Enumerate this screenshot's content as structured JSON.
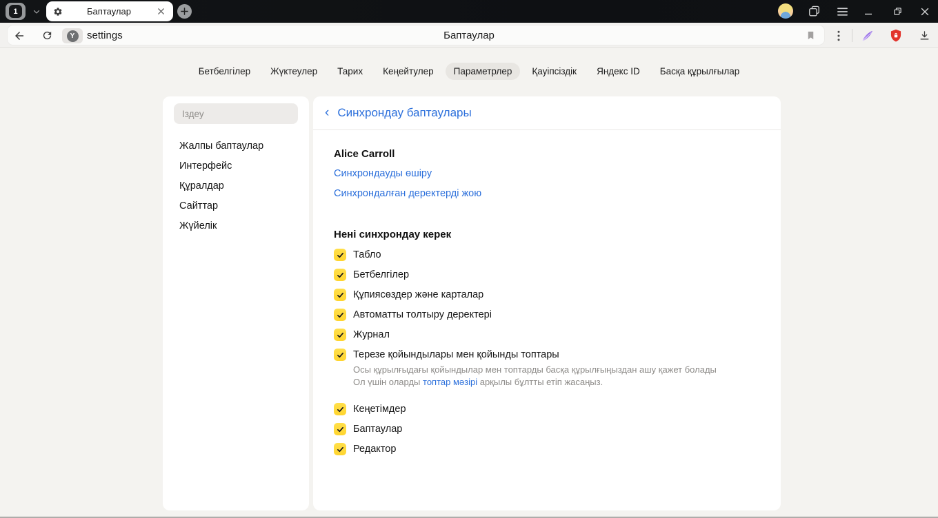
{
  "window": {
    "tab_count": "1",
    "tab_title": "Баптаулар",
    "address": "settings",
    "page_title": "Баптаулар"
  },
  "icons": {
    "tab_favicon": "gear",
    "new_tab": "+",
    "toolbar": [
      "back-arrow",
      "refresh",
      "site-badge",
      "bookmark-flag",
      "more-dots",
      "feather-extension",
      "protect-shield",
      "download-arrow"
    ],
    "titlebar": [
      "tab-counter",
      "chevron-down",
      "avatar",
      "collections",
      "hamburger-menu",
      "minimize",
      "restore",
      "close"
    ]
  },
  "colors": {
    "accent_blue": "#2b6fdb",
    "checkbox_yellow": "#ffd93d",
    "protect_red": "#e2342c",
    "feather_purple": "#9a63e8",
    "tabstrip_dark": "#101214"
  },
  "nav_tabs": [
    {
      "label": "Бетбелгілер",
      "active": false
    },
    {
      "label": "Жүктеулер",
      "active": false
    },
    {
      "label": "Тарих",
      "active": false
    },
    {
      "label": "Кеңейтулер",
      "active": false
    },
    {
      "label": "Параметрлер",
      "active": true
    },
    {
      "label": "Қауіпсіздік",
      "active": false
    },
    {
      "label": "Яндекс ID",
      "active": false
    },
    {
      "label": "Басқа құрылғылар",
      "active": false
    }
  ],
  "sidebar": {
    "search_placeholder": "Іздеу",
    "items": [
      "Жалпы баптаулар",
      "Интерфейс",
      "Құралдар",
      "Сайттар",
      "Жүйелік"
    ]
  },
  "main": {
    "back_chevron": "‹",
    "title": "Синхрондау баптаулары",
    "account_name": "Alice Carroll",
    "disable_sync_link": "Синхрондауды өшіру",
    "delete_synced_data_link": "Синхрондалған деректерді жою",
    "section_title": "Нені синхрондау керек",
    "checkboxes": [
      {
        "label": "Табло",
        "checked": true
      },
      {
        "label": "Бетбелгілер",
        "checked": true
      },
      {
        "label": "Құпиясөздер және карталар",
        "checked": true
      },
      {
        "label": "Автоматты толтыру деректері",
        "checked": true
      },
      {
        "label": "Журнал",
        "checked": true
      },
      {
        "label": "Терезе қойындылары мен қойынды топтары",
        "checked": true,
        "description_line1": "Осы құрылғыдағы қойындылар мен топтарды басқа құрылғыңыздан ашу қажет болады",
        "description_prefix": "Ол үшін оларды ",
        "description_link": "топтар мәзірі",
        "description_suffix": " арқылы бұлтты етіп жасаңыз."
      },
      {
        "label": "Кеңетімдер",
        "checked": true
      },
      {
        "label": "Баптаулар",
        "checked": true
      },
      {
        "label": "Редактор",
        "checked": true
      }
    ]
  }
}
